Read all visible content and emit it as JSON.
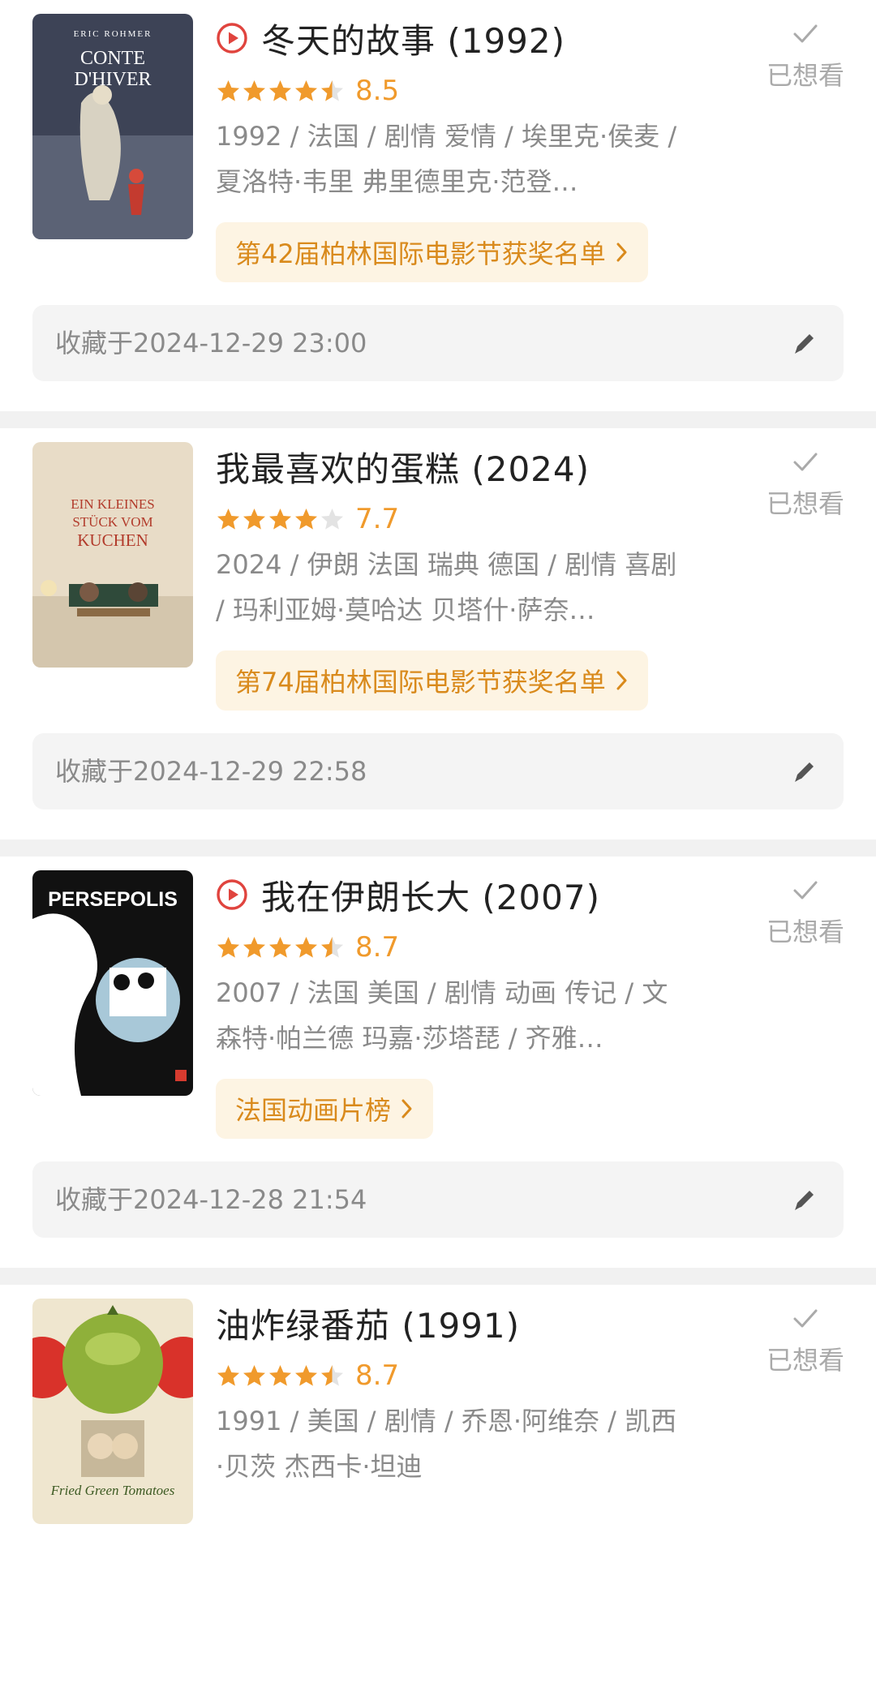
{
  "colors": {
    "accent_orange": "#f09a2c",
    "tag_bg": "#fdf4e3",
    "tag_text": "#d98a1c",
    "play_red": "#e0443e",
    "divider": "#f1f1f1",
    "collect_bg": "#f4f4f4"
  },
  "icons": {
    "play": "play-circle-icon",
    "star": "star-icon",
    "check": "check-icon",
    "edit": "pencil-icon",
    "arrow": "chevron-right-icon"
  },
  "items": [
    {
      "title": "冬天的故事 (1992)",
      "has_play": true,
      "stars": 4.5,
      "score": "8.5",
      "meta": "1992 / 法国 / 剧情 爱情 / 埃里克·侯麦 / 夏洛特·韦里 弗里德里克·范登…",
      "rank": "第42届柏林国际电影节获奖名单",
      "wish_label": "已想看",
      "collected": "收藏于2024-12-29 23:00",
      "poster": {
        "lines": [
          "ERIC ROHMER",
          "CONTE",
          "D'HIVER"
        ],
        "bg": "#3d4356"
      }
    },
    {
      "title": "我最喜欢的蛋糕 (2024)",
      "has_play": false,
      "stars": 4,
      "score": "7.7",
      "meta": "2024 / 伊朗 法国 瑞典 德国 / 剧情 喜剧 / 玛利亚姆·莫哈达 贝塔什·萨奈…",
      "rank": "第74届柏林国际电影节获奖名单",
      "wish_label": "已想看",
      "collected": "收藏于2024-12-29 22:58",
      "poster": {
        "lines": [
          "EIN KLEINES",
          "STÜCK VOM",
          "KUCHEN"
        ],
        "bg": "#e8dcc7"
      }
    },
    {
      "title": "我在伊朗长大 (2007)",
      "has_play": true,
      "stars": 4.5,
      "score": "8.7",
      "meta": "2007 / 法国 美国 / 剧情 动画 传记 / 文森特·帕兰德 玛嘉·莎塔琵 / 齐雅…",
      "rank": "法国动画片榜",
      "wish_label": "已想看",
      "collected": "收藏于2024-12-28 21:54",
      "poster": {
        "lines": [
          "PERSEPOLIS"
        ],
        "bg": "#111111"
      }
    },
    {
      "title": "油炸绿番茄 (1991)",
      "has_play": false,
      "stars": 4.5,
      "score": "8.7",
      "meta": "1991 / 美国 / 剧情 / 乔恩·阿维奈 / 凯西·贝茨 杰西卡·坦迪",
      "rank": "",
      "wish_label": "已想看",
      "collected": "",
      "poster": {
        "lines": [
          "Fried Green Tomatoes"
        ],
        "bg": "#efe6cf"
      }
    }
  ]
}
